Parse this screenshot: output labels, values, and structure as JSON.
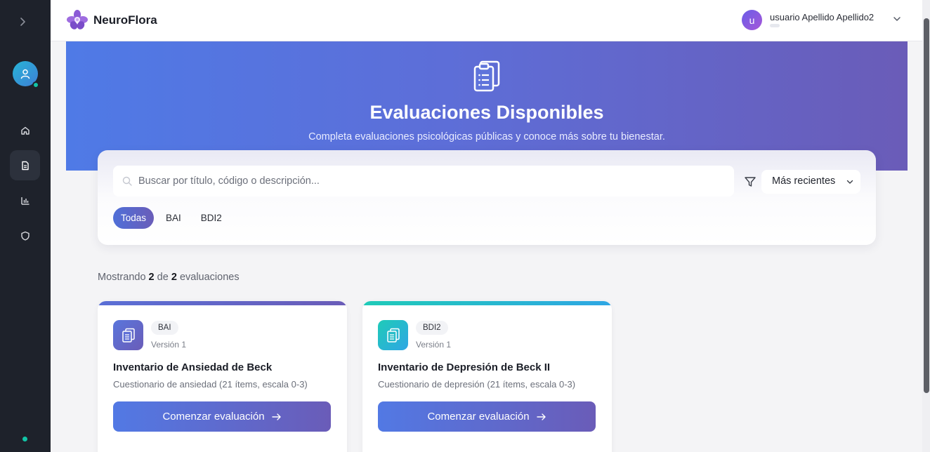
{
  "app": {
    "brand": "NeuroFlora"
  },
  "user": {
    "name": "usuario Apellido Apellido2",
    "initial": "u"
  },
  "sidebar": {
    "items": [
      {
        "name": "home",
        "icon": "home-icon",
        "active": false
      },
      {
        "name": "evaluations",
        "icon": "document-icon",
        "active": true
      },
      {
        "name": "stats",
        "icon": "bar-chart-icon",
        "active": false
      },
      {
        "name": "security",
        "icon": "shield-icon",
        "active": false
      }
    ]
  },
  "hero": {
    "title": "Evaluaciones Disponibles",
    "subtitle": "Completa evaluaciones psicológicas públicas y conoce más sobre tu bienestar."
  },
  "search": {
    "placeholder": "Buscar por título, código o descripción...",
    "value": ""
  },
  "sort": {
    "selected": "Más recientes"
  },
  "filters": {
    "chips": [
      "Todas",
      "BAI",
      "BDI2"
    ],
    "active": "Todas"
  },
  "results": {
    "prefix": "Mostrando",
    "shown": "2",
    "middle": "de",
    "total": "2",
    "suffix": "evaluaciones"
  },
  "evaluations": [
    {
      "code": "BAI",
      "version": "Versión 1",
      "title": "Inventario de Ansiedad de Beck",
      "description": "Cuestionario de ansiedad (21 ítems, escala 0-3)",
      "button": "Comenzar evaluación",
      "accent": "#5c6ad0"
    },
    {
      "code": "BDI2",
      "version": "Versión 1",
      "title": "Inventario de Depresión de Beck II",
      "description": "Cuestionario de depresión (21 ítems, escala 0-3)",
      "button": "Comenzar evaluación",
      "accent": "#1fc4c4"
    }
  ],
  "colors": {
    "sidebar_bg": "#1e222b",
    "accent_start": "#4f7ae6",
    "accent_end": "#6a5cb8",
    "online": "#12c4a6"
  }
}
